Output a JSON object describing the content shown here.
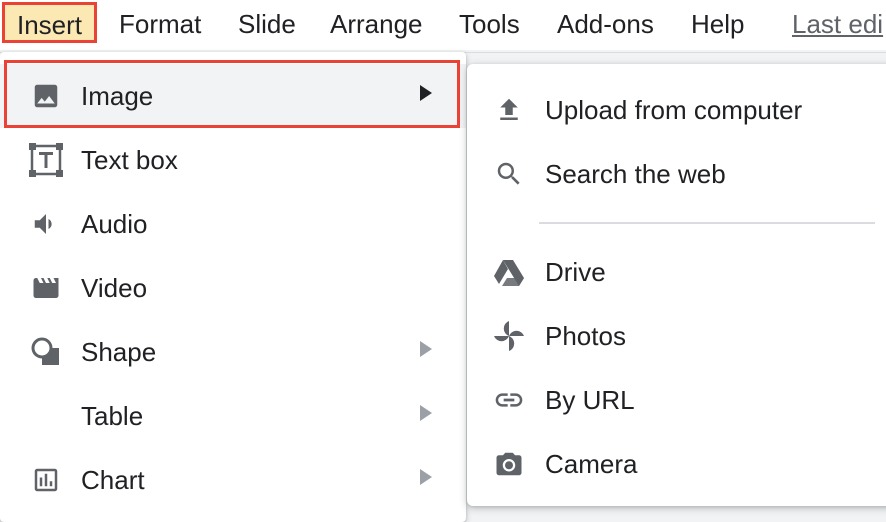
{
  "menubar": {
    "insert": "Insert",
    "format": "Format",
    "slide": "Slide",
    "arrange": "Arrange",
    "tools": "Tools",
    "addons": "Add-ons",
    "help": "Help",
    "last_edit": "Last edi"
  },
  "insert_menu": {
    "items": [
      {
        "label": "Image",
        "icon": "image-icon",
        "has_submenu": true,
        "active": true
      },
      {
        "label": "Text box",
        "icon": "text-box-icon",
        "has_submenu": false
      },
      {
        "label": "Audio",
        "icon": "audio-icon",
        "has_submenu": false
      },
      {
        "label": "Video",
        "icon": "video-icon",
        "has_submenu": false
      },
      {
        "label": "Shape",
        "icon": "shape-icon",
        "has_submenu": true
      },
      {
        "label": "Table",
        "icon": "",
        "has_submenu": true
      },
      {
        "label": "Chart",
        "icon": "chart-icon",
        "has_submenu": true
      }
    ]
  },
  "image_submenu": {
    "items": [
      {
        "label": "Upload from computer",
        "icon": "upload-icon"
      },
      {
        "label": "Search the web",
        "icon": "search-icon"
      },
      {
        "label": "Drive",
        "icon": "drive-icon"
      },
      {
        "label": "Photos",
        "icon": "photos-icon"
      },
      {
        "label": "By URL",
        "icon": "link-icon"
      },
      {
        "label": "Camera",
        "icon": "camera-icon"
      }
    ]
  },
  "colors": {
    "highlight_border": "#ea4335",
    "insert_background": "#fce8b2",
    "icon": "#5f6368"
  }
}
